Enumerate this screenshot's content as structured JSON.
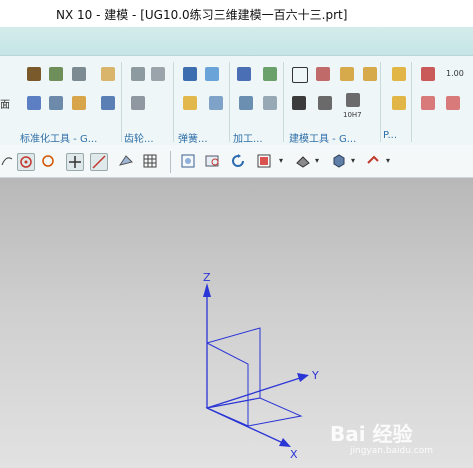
{
  "window": {
    "title": "NX 10 - 建模 - [UG10.0练习三维建模一百六十三.prt]"
  },
  "ribbon": {
    "groups": [
      {
        "label": "标准化工具 - G..."
      },
      {
        "label": "齿轮..."
      },
      {
        "label": "弹簧..."
      },
      {
        "label": "加工..."
      },
      {
        "label": "建模工具 - G..."
      },
      {
        "label": "P..."
      }
    ],
    "small_texts": {
      "face_label": "面",
      "scale_label": "1.00",
      "h7_label": "10H7"
    }
  },
  "viewport": {
    "axes": {
      "z": "Z",
      "y": "Y",
      "x": "X"
    },
    "axis_color": "#2a35d6",
    "watermark": "Bai 经验",
    "watermark_sub": "jingyan.baidu.com"
  }
}
